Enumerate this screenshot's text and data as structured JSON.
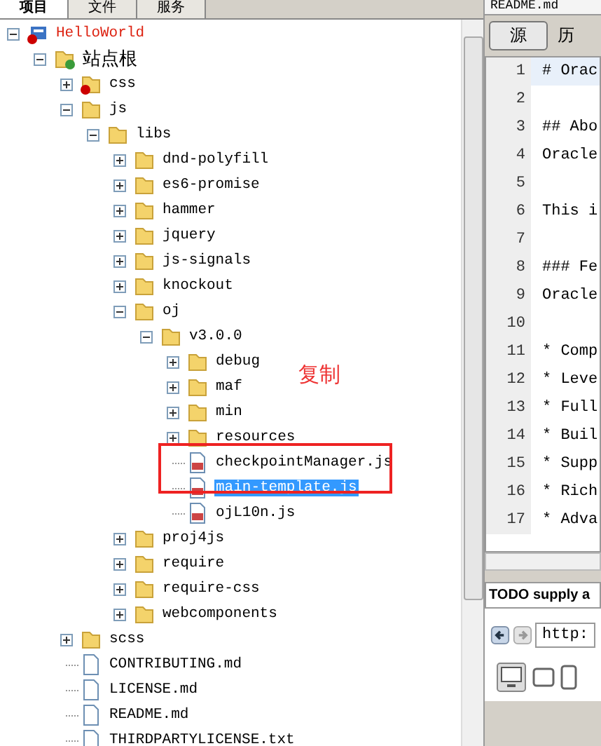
{
  "left_tabs": [
    {
      "label": "项目",
      "selected": true
    },
    {
      "label": "文件",
      "selected": false
    },
    {
      "label": "服务",
      "selected": false
    }
  ],
  "tree": [
    {
      "label": "HelloWorld",
      "kind": "project",
      "error": true,
      "expanded": true,
      "selected": false,
      "children": [
        {
          "label": "站点根",
          "kind": "webroot",
          "error": false,
          "expanded": true,
          "selected": false,
          "children": [
            {
              "label": "css",
              "kind": "folder",
              "error": true,
              "expanded": false,
              "selected": false
            },
            {
              "label": "js",
              "kind": "folder",
              "error": false,
              "expanded": true,
              "selected": false,
              "children": [
                {
                  "label": "libs",
                  "kind": "folder",
                  "error": false,
                  "expanded": true,
                  "selected": false,
                  "children": [
                    {
                      "label": "dnd-polyfill",
                      "kind": "folder",
                      "error": false,
                      "expanded": false,
                      "selected": false
                    },
                    {
                      "label": "es6-promise",
                      "kind": "folder",
                      "error": false,
                      "expanded": false,
                      "selected": false
                    },
                    {
                      "label": "hammer",
                      "kind": "folder",
                      "error": false,
                      "expanded": false,
                      "selected": false
                    },
                    {
                      "label": "jquery",
                      "kind": "folder",
                      "error": false,
                      "expanded": false,
                      "selected": false
                    },
                    {
                      "label": "js-signals",
                      "kind": "folder",
                      "error": false,
                      "expanded": false,
                      "selected": false
                    },
                    {
                      "label": "knockout",
                      "kind": "folder",
                      "error": false,
                      "expanded": false,
                      "selected": false
                    },
                    {
                      "label": "oj",
                      "kind": "folder",
                      "error": false,
                      "expanded": true,
                      "selected": false,
                      "children": [
                        {
                          "label": "v3.0.0",
                          "kind": "folder",
                          "error": false,
                          "expanded": true,
                          "selected": false,
                          "children": [
                            {
                              "label": "debug",
                              "kind": "folder",
                              "error": false,
                              "expanded": false,
                              "selected": false
                            },
                            {
                              "label": "maf",
                              "kind": "folder",
                              "error": false,
                              "expanded": false,
                              "selected": false
                            },
                            {
                              "label": "min",
                              "kind": "folder",
                              "error": false,
                              "expanded": false,
                              "selected": false
                            },
                            {
                              "label": "resources",
                              "kind": "folder",
                              "error": false,
                              "expanded": false,
                              "selected": false
                            },
                            {
                              "label": "checkpointManager.js",
                              "kind": "js",
                              "error": false,
                              "selected": false
                            },
                            {
                              "label": "main-template.js",
                              "kind": "js",
                              "error": false,
                              "selected": true
                            },
                            {
                              "label": "ojL10n.js",
                              "kind": "js",
                              "error": false,
                              "selected": false
                            }
                          ]
                        }
                      ]
                    },
                    {
                      "label": "proj4js",
                      "kind": "folder",
                      "error": false,
                      "expanded": false,
                      "selected": false
                    },
                    {
                      "label": "require",
                      "kind": "folder",
                      "error": false,
                      "expanded": false,
                      "selected": false
                    },
                    {
                      "label": "require-css",
                      "kind": "folder",
                      "error": false,
                      "expanded": false,
                      "selected": false
                    },
                    {
                      "label": "webcomponents",
                      "kind": "folder",
                      "error": false,
                      "expanded": false,
                      "selected": false
                    }
                  ]
                }
              ]
            },
            {
              "label": "scss",
              "kind": "folder",
              "error": false,
              "expanded": false,
              "selected": false
            },
            {
              "label": "CONTRIBUTING.md",
              "kind": "file",
              "error": false,
              "selected": false
            },
            {
              "label": "LICENSE.md",
              "kind": "file",
              "error": false,
              "selected": false
            },
            {
              "label": "README.md",
              "kind": "file",
              "error": false,
              "selected": false
            },
            {
              "label": "THIRDPARTYLICENSE.txt",
              "kind": "file",
              "error": false,
              "selected": false
            }
          ]
        }
      ]
    }
  ],
  "annotation": {
    "text": "复制"
  },
  "editor": {
    "tab": "README.md",
    "view_buttons": [
      {
        "label": "源",
        "selected": true
      },
      {
        "label": "历",
        "selected": false
      }
    ],
    "lines": [
      {
        "number": "1",
        "text": "# Orac",
        "current": true
      },
      {
        "number": "2",
        "current": false
      },
      {
        "number": "3",
        "text": "## Abo",
        "current": false
      },
      {
        "number": "4",
        "text": "Oracle",
        "current": false
      },
      {
        "number": "5",
        "current": false
      },
      {
        "number": "6",
        "text": "This i",
        "current": false
      },
      {
        "number": "7",
        "current": false
      },
      {
        "number": "8",
        "text": "### Fe",
        "current": false
      },
      {
        "number": "9",
        "text": "Oracle",
        "current": false
      },
      {
        "number": "10",
        "current": false
      },
      {
        "number": "11",
        "text": "* Comp",
        "current": false
      },
      {
        "number": "12",
        "text": "* Leve",
        "current": false
      },
      {
        "number": "13",
        "text": "* Full",
        "current": false
      },
      {
        "number": "14",
        "text": "* Buil",
        "current": false
      },
      {
        "number": "15",
        "text": "* Supp",
        "current": false
      },
      {
        "number": "16",
        "text": "* Rich",
        "current": false
      },
      {
        "number": "17",
        "text": "* Adva",
        "current": false
      }
    ]
  },
  "browser": {
    "title": "TODO supply a",
    "url": "http:"
  }
}
